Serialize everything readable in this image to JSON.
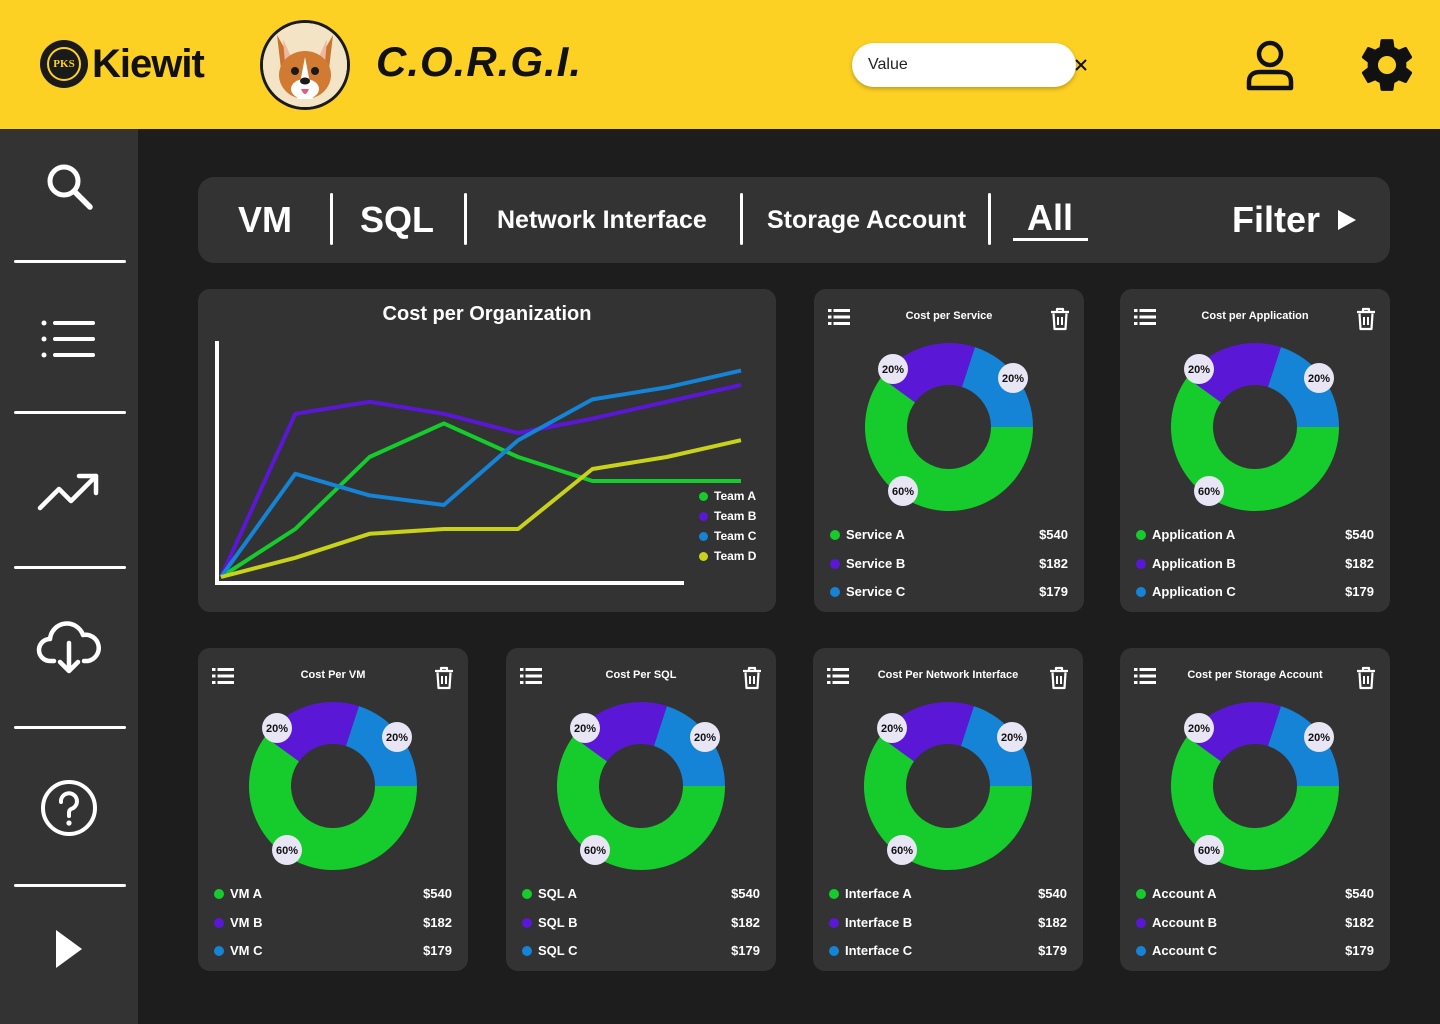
{
  "header": {
    "brand": "Kiewit",
    "seal_text": "PKS",
    "app_title": "C.O.R.G.I.",
    "search_value": "Value"
  },
  "tabs": {
    "items": [
      "VM",
      "SQL",
      "Network Interface",
      "Storage Account",
      "All"
    ],
    "active": "All",
    "filter_label": "Filter"
  },
  "colors": {
    "green": "#16cc2c",
    "purple": "#5b17d6",
    "blue": "#1583d6",
    "yellow": "#c8d21b",
    "accent": "#fdd024"
  },
  "org_chart": {
    "title": "Cost per Organization",
    "legend": [
      "Team A",
      "Team B",
      "Team C",
      "Team D"
    ]
  },
  "cards": [
    {
      "title": "Cost per Service",
      "labels": [
        "Service A",
        "Service B",
        "Service C"
      ],
      "values": [
        "$540",
        "$182",
        "$179"
      ],
      "slices": [
        "20%",
        "20%",
        "60%"
      ]
    },
    {
      "title": "Cost per Application",
      "labels": [
        "Application A",
        "Application B",
        "Application C"
      ],
      "values": [
        "$540",
        "$182",
        "$179"
      ],
      "slices": [
        "20%",
        "20%",
        "60%"
      ]
    },
    {
      "title": "Cost Per VM",
      "labels": [
        "VM A",
        "VM B",
        "VM C"
      ],
      "values": [
        "$540",
        "$182",
        "$179"
      ],
      "slices": [
        "20%",
        "20%",
        "60%"
      ]
    },
    {
      "title": "Cost Per SQL",
      "labels": [
        "SQL A",
        "SQL B",
        "SQL C"
      ],
      "values": [
        "$540",
        "$182",
        "$179"
      ],
      "slices": [
        "20%",
        "20%",
        "60%"
      ]
    },
    {
      "title": "Cost Per Network Interface",
      "labels": [
        "Interface A",
        "Interface B",
        "Interface C"
      ],
      "values": [
        "$540",
        "$182",
        "$179"
      ],
      "slices": [
        "20%",
        "20%",
        "60%"
      ]
    },
    {
      "title": "Cost per Storage Account",
      "labels": [
        "Account A",
        "Account B",
        "Account C"
      ],
      "values": [
        "$540",
        "$182",
        "$179"
      ],
      "slices": [
        "20%",
        "20%",
        "60%"
      ]
    }
  ],
  "chart_data": [
    {
      "type": "line",
      "title": "Cost per Organization",
      "xlabel": "",
      "ylabel": "",
      "x": [
        0,
        1,
        2,
        3,
        4,
        5,
        6,
        7
      ],
      "series": [
        {
          "name": "Team A",
          "values": [
            0,
            20,
            50,
            64,
            50,
            40,
            40,
            40
          ]
        },
        {
          "name": "Team B",
          "values": [
            0,
            68,
            73,
            68,
            60,
            66,
            73,
            80
          ]
        },
        {
          "name": "Team C",
          "values": [
            0,
            43,
            34,
            30,
            57,
            74,
            79,
            86
          ]
        },
        {
          "name": "Team D",
          "values": [
            0,
            8,
            18,
            20,
            20,
            45,
            50,
            57
          ]
        }
      ],
      "grid": false,
      "legend_position": "right"
    },
    {
      "type": "pie",
      "title": "Cost per Service",
      "categories": [
        "Service A",
        "Service B",
        "Service C"
      ],
      "values": [
        60,
        20,
        20
      ]
    },
    {
      "type": "pie",
      "title": "Cost per Application",
      "categories": [
        "Application A",
        "Application B",
        "Application C"
      ],
      "values": [
        60,
        20,
        20
      ]
    },
    {
      "type": "pie",
      "title": "Cost Per VM",
      "categories": [
        "VM A",
        "VM B",
        "VM C"
      ],
      "values": [
        60,
        20,
        20
      ]
    },
    {
      "type": "pie",
      "title": "Cost Per SQL",
      "categories": [
        "SQL A",
        "SQL B",
        "SQL C"
      ],
      "values": [
        60,
        20,
        20
      ]
    },
    {
      "type": "pie",
      "title": "Cost Per Network Interface",
      "categories": [
        "Interface A",
        "Interface B",
        "Interface C"
      ],
      "values": [
        60,
        20,
        20
      ]
    },
    {
      "type": "pie",
      "title": "Cost per Storage Account",
      "categories": [
        "Account A",
        "Account B",
        "Account C"
      ],
      "values": [
        60,
        20,
        20
      ]
    }
  ]
}
